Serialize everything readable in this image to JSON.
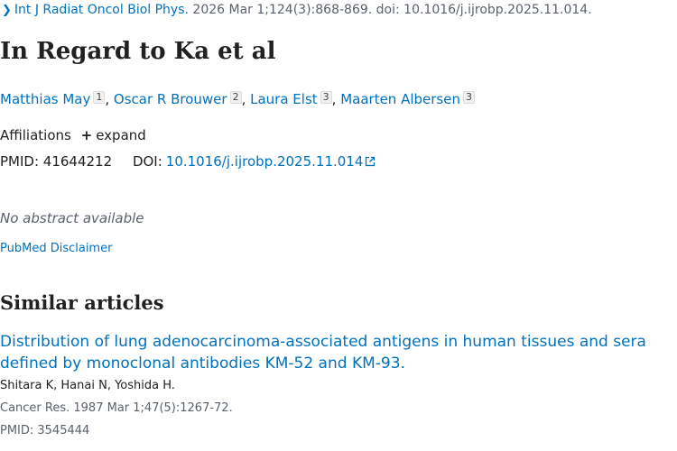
{
  "citation": {
    "journal": "Int J Radiat Oncol Biol Phys.",
    "details": "2026 Mar 1;124(3):868-869. doi: 10.1016/j.ijrobp.2025.11.014."
  },
  "article": {
    "title": "In Regard to Ka et al",
    "authors": [
      {
        "name": "Matthias May",
        "aff": "1"
      },
      {
        "name": "Oscar R Brouwer",
        "aff": "2"
      },
      {
        "name": "Laura Elst",
        "aff": "3"
      },
      {
        "name": "Maarten Albersen",
        "aff": "3"
      }
    ],
    "affiliations_label": "Affiliations",
    "expand_label": "expand",
    "pmid_label": "PMID:",
    "pmid": "41644212",
    "doi_label": "DOI:",
    "doi": "10.1016/j.ijrobp.2025.11.014",
    "abstract_status": "No abstract available",
    "disclaimer": "PubMed Disclaimer"
  },
  "similar": {
    "heading": "Similar articles",
    "items": [
      {
        "title": "Distribution of lung adenocarcinoma-associated antigens in human tissues and sera defined by monoclonal antibodies KM-52 and KM-93.",
        "authors": "Shitara K, Hanai N, Yoshida H.",
        "citation": "Cancer Res. 1987 Mar 1;47(5):1267-72.",
        "pmid": "PMID: 3545444"
      }
    ]
  },
  "icons": {
    "citation_chevron": "chevron-right-icon",
    "expand": "plus-icon",
    "external": "external-link-icon"
  },
  "colors": {
    "link": "#0071bc",
    "text": "#212121",
    "muted": "#5b616b"
  }
}
